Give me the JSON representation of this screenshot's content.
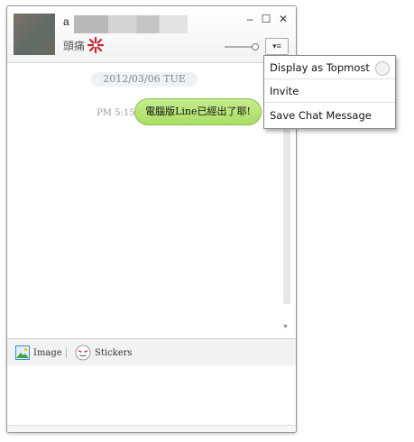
{
  "header": {
    "name_prefix": "a",
    "status_text": "頭痛",
    "window_controls": {
      "minimize": "–",
      "maximize": "☐",
      "close": "✕"
    },
    "menu_button_label": "▾≡"
  },
  "chat": {
    "date": "2012/03/06 TUE",
    "messages": [
      {
        "time": "PM 5:15",
        "text": "電腦版Line已經出了耶!"
      }
    ]
  },
  "toolbar": {
    "image_label": "Image",
    "stickers_label": "Stickers"
  },
  "menu": {
    "items": [
      {
        "label": "Display as Topmost",
        "has_toggle": true
      },
      {
        "label": "Invite"
      },
      {
        "label": "Save Chat Message"
      }
    ]
  },
  "colors": {
    "bubble": "#a9dd66",
    "status_icon": "#c0272d"
  }
}
